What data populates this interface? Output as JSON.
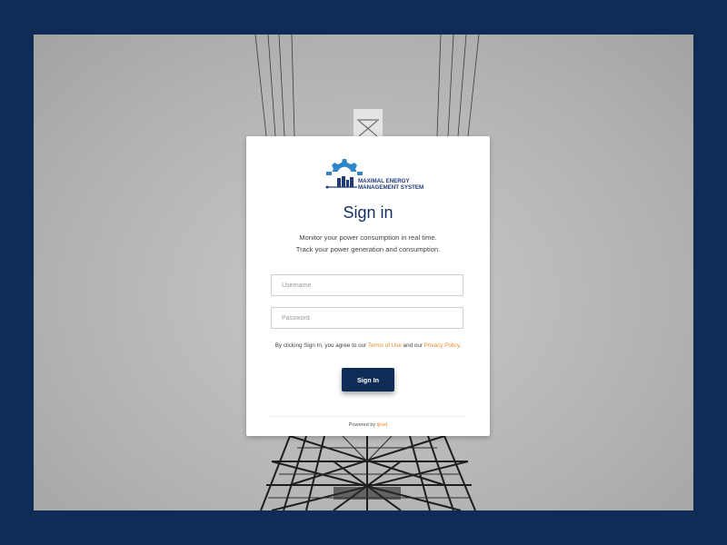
{
  "colors": {
    "page_background": "#0f2c56",
    "primary": "#0f2c56",
    "title": "#15305e",
    "link": "#e58a2c",
    "logo_blue": "#213b79",
    "logo_gear": "#2e86c8"
  },
  "background": {
    "description_icon": "power-tower-photo"
  },
  "logo": {
    "icon": "gear-energy-logo-icon",
    "line1": "MAXIMAL ENERGY",
    "line2": "MANAGEMENT SYSTEM"
  },
  "login": {
    "title": "Sign in",
    "subtitle_line1": "Monitor your power consumption in real time.",
    "subtitle_line2": "Track your power generation and consumption.",
    "username_placeholder": "Username",
    "username_value": "",
    "password_placeholder": "Password",
    "password_value": "",
    "agreement_prefix": "By clicking Sign In, you agree to our ",
    "terms_link": "Terms of Use",
    "agreement_middle": " and our ",
    "privacy_link": "Privacy Policy",
    "agreement_suffix": ".",
    "sign_in_button": "Sign In"
  },
  "footer": {
    "powered_prefix": "Powered by ",
    "powered_brand": "ijkod"
  }
}
